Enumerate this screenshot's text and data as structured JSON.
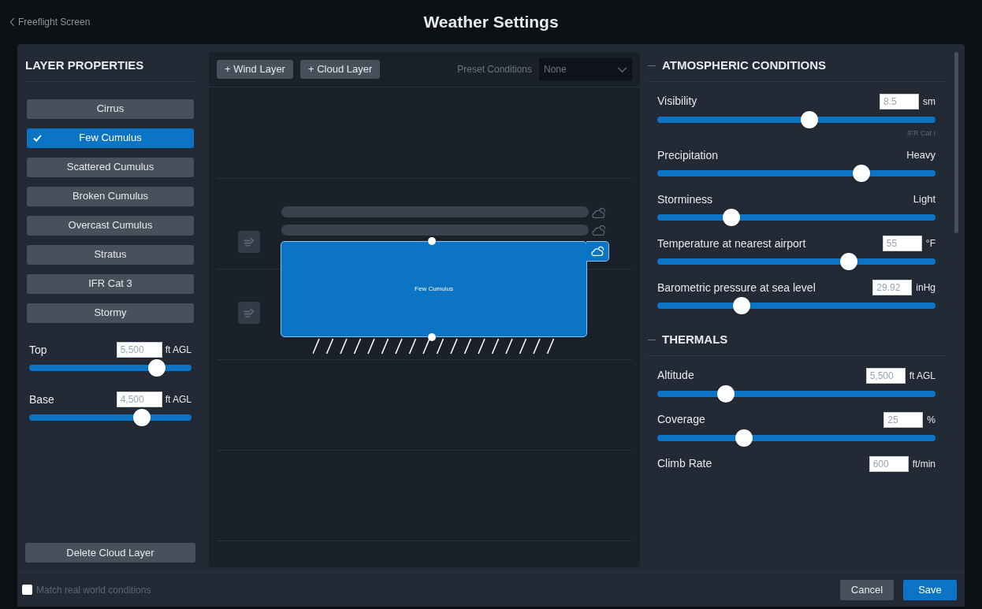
{
  "header": {
    "back_link": "Freeflight Screen",
    "title": "Weather Settings"
  },
  "layer_properties": {
    "title": "LAYER PROPERTIES",
    "layers": [
      {
        "label": "Cirrus",
        "selected": false
      },
      {
        "label": "Few Cumulus",
        "selected": true
      },
      {
        "label": "Scattered Cumulus",
        "selected": false
      },
      {
        "label": "Broken Cumulus",
        "selected": false
      },
      {
        "label": "Overcast Cumulus",
        "selected": false
      },
      {
        "label": "Stratus",
        "selected": false
      },
      {
        "label": "IFR Cat 3",
        "selected": false
      },
      {
        "label": "Stormy",
        "selected": false
      }
    ],
    "controls": [
      {
        "label": "Top",
        "value": "5,500",
        "unit": "ft AGL",
        "level": 0.82
      },
      {
        "label": "Base",
        "value": "4,500",
        "unit": "ft AGL",
        "level": 0.72
      }
    ],
    "delete_button": "Delete Cloud Layer"
  },
  "editor": {
    "buttons": [
      "+ Wind Layer",
      "+ Cloud Layer"
    ],
    "preset": {
      "label": "Preset Conditions",
      "value": "None"
    },
    "selected_layer_label": "Few Cumulus"
  },
  "sections": [
    {
      "title": "ATMOSPHERIC CONDITIONS",
      "items": [
        {
          "kind": "field",
          "label": "Visibility",
          "value": "8.5",
          "unit": "sm",
          "level": 0.55,
          "note": "IFR Cat I"
        },
        {
          "kind": "reading",
          "label": "Precipitation",
          "reading": "Heavy",
          "level": 0.75
        },
        {
          "kind": "reading",
          "label": "Storminess",
          "reading": "Light",
          "level": 0.25
        },
        {
          "kind": "field",
          "label": "Temperature at nearest airport",
          "value": "55",
          "unit": "°F",
          "level": 0.7
        },
        {
          "kind": "field",
          "label": "Barometric pressure at sea level",
          "value": "29.92",
          "unit": "inHg",
          "level": 0.29
        }
      ]
    },
    {
      "title": "THERMALS",
      "items": [
        {
          "kind": "field",
          "label": "Altitude",
          "value": "5,500",
          "unit": "ft AGL",
          "level": 0.23
        },
        {
          "kind": "field",
          "label": "Coverage",
          "value": "25",
          "unit": "%",
          "level": 0.3
        },
        {
          "kind": "field",
          "label": "Climb Rate",
          "value": "600",
          "unit": "ft/min"
        }
      ]
    }
  ],
  "footer": {
    "match_real_world": {
      "label": "Match real world conditions",
      "checked": false
    },
    "buttons": [
      {
        "label": "Cancel",
        "kind": "secondary"
      },
      {
        "label": "Save",
        "kind": "primary"
      }
    ]
  }
}
